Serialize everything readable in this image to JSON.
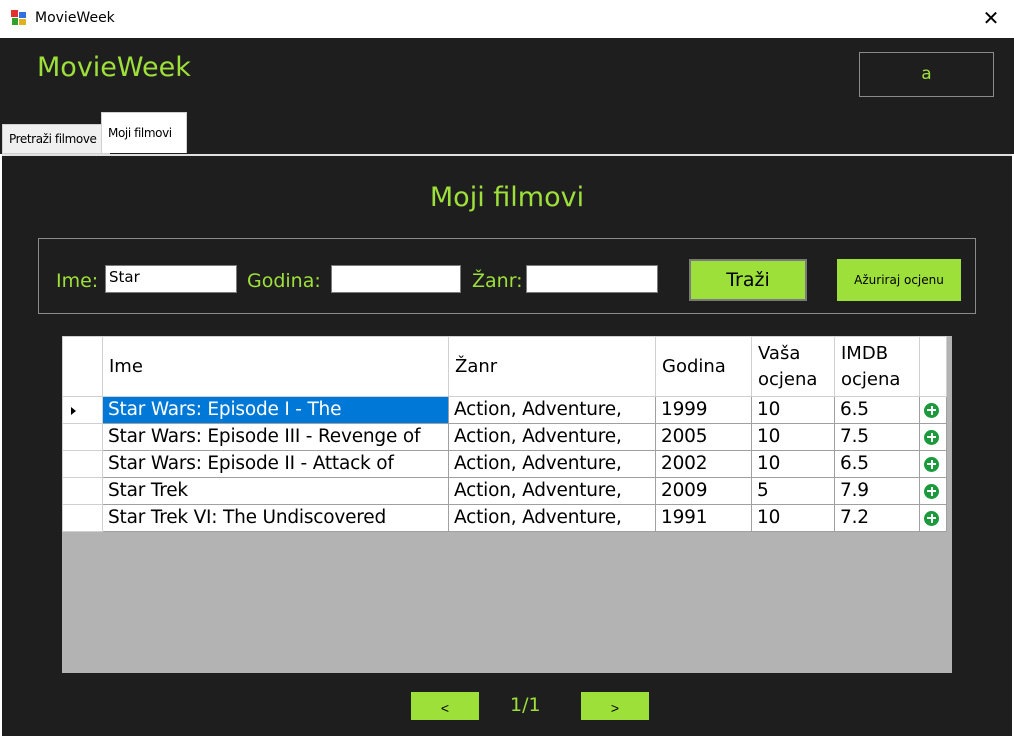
{
  "window": {
    "title": "MovieWeek",
    "close_glyph": "✕"
  },
  "header": {
    "logo": "MovieWeek",
    "user": "a"
  },
  "tabs": [
    {
      "label": "Pretraži filmove"
    },
    {
      "label": "Moji filmovi"
    }
  ],
  "panel": {
    "title": "Moji filmovi"
  },
  "filters": {
    "name_label": "Ime:",
    "name_value": "Star",
    "year_label": "Godina:",
    "year_value": "",
    "genre_label": "Žanr:",
    "genre_value": "",
    "search_button": "Traži",
    "update_rating_button": "Ažuriraj ocjenu"
  },
  "grid": {
    "columns": [
      "Ime",
      "Žanr",
      "Godina",
      "Vaša ocjena",
      "IMDB ocjena"
    ],
    "rows": [
      {
        "name": "Star Wars: Episode I - The",
        "genre": "Action, Adventure,",
        "year": "1999",
        "your_rating": "10",
        "imdb": "6.5"
      },
      {
        "name": "Star Wars: Episode III - Revenge of",
        "genre": "Action, Adventure,",
        "year": "2005",
        "your_rating": "10",
        "imdb": "7.5"
      },
      {
        "name": "Star Wars: Episode II - Attack of",
        "genre": "Action, Adventure,",
        "year": "2002",
        "your_rating": "10",
        "imdb": "6.5"
      },
      {
        "name": "Star Trek",
        "genre": "Action, Adventure,",
        "year": "2009",
        "your_rating": "5",
        "imdb": "7.9"
      },
      {
        "name": "Star Trek VI: The Undiscovered",
        "genre": "Action, Adventure,",
        "year": "1991",
        "your_rating": "10",
        "imdb": "7.2"
      }
    ]
  },
  "pager": {
    "prev": "<",
    "next": ">",
    "info": "1/1"
  },
  "colors": {
    "accent": "#9ee03a",
    "background": "#1e1e1e",
    "selection": "#0078d7",
    "add_icon": "#1a9a3a"
  }
}
